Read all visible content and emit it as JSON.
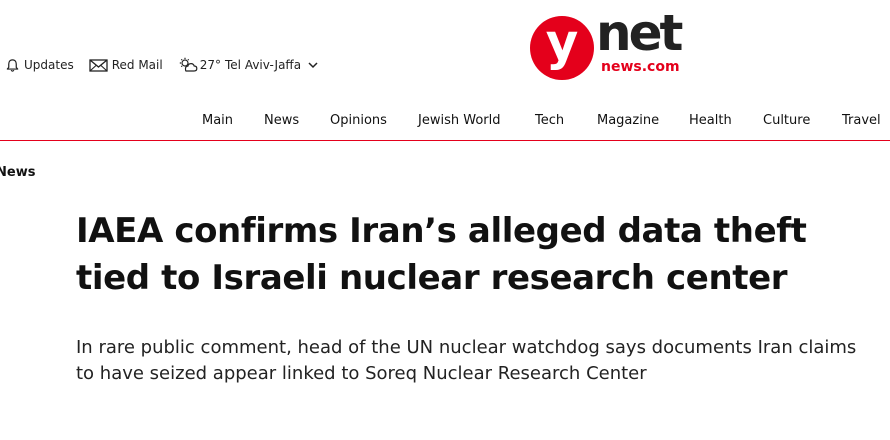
{
  "utility": {
    "updates_label": "Updates",
    "mail_label": "Red Mail",
    "temperature": "27°",
    "city": "Tel Aviv-Jaffa"
  },
  "logo": {
    "y_letter": "y",
    "net": "net",
    "domain": "news.com"
  },
  "nav": {
    "items": [
      {
        "label": "Main"
      },
      {
        "label": "News"
      },
      {
        "label": "Opinions"
      },
      {
        "label": "Jewish World"
      },
      {
        "label": "Tech"
      },
      {
        "label": "Magazine"
      },
      {
        "label": "Health"
      },
      {
        "label": "Culture"
      },
      {
        "label": "Travel"
      }
    ]
  },
  "article": {
    "section": "News",
    "headline": "IAEA confirms Iran’s alleged data theft tied to Israeli nuclear research center",
    "subheadline": "In rare public comment, head of the UN nuclear watchdog says documents Iran claims to have seized appear linked to Soreq Nuclear Research Center"
  },
  "colors": {
    "brand_red": "#e4001b",
    "text": "#111111"
  },
  "icons": [
    "bell-icon",
    "mail-icon",
    "weather-icon",
    "chevron-down-icon"
  ]
}
